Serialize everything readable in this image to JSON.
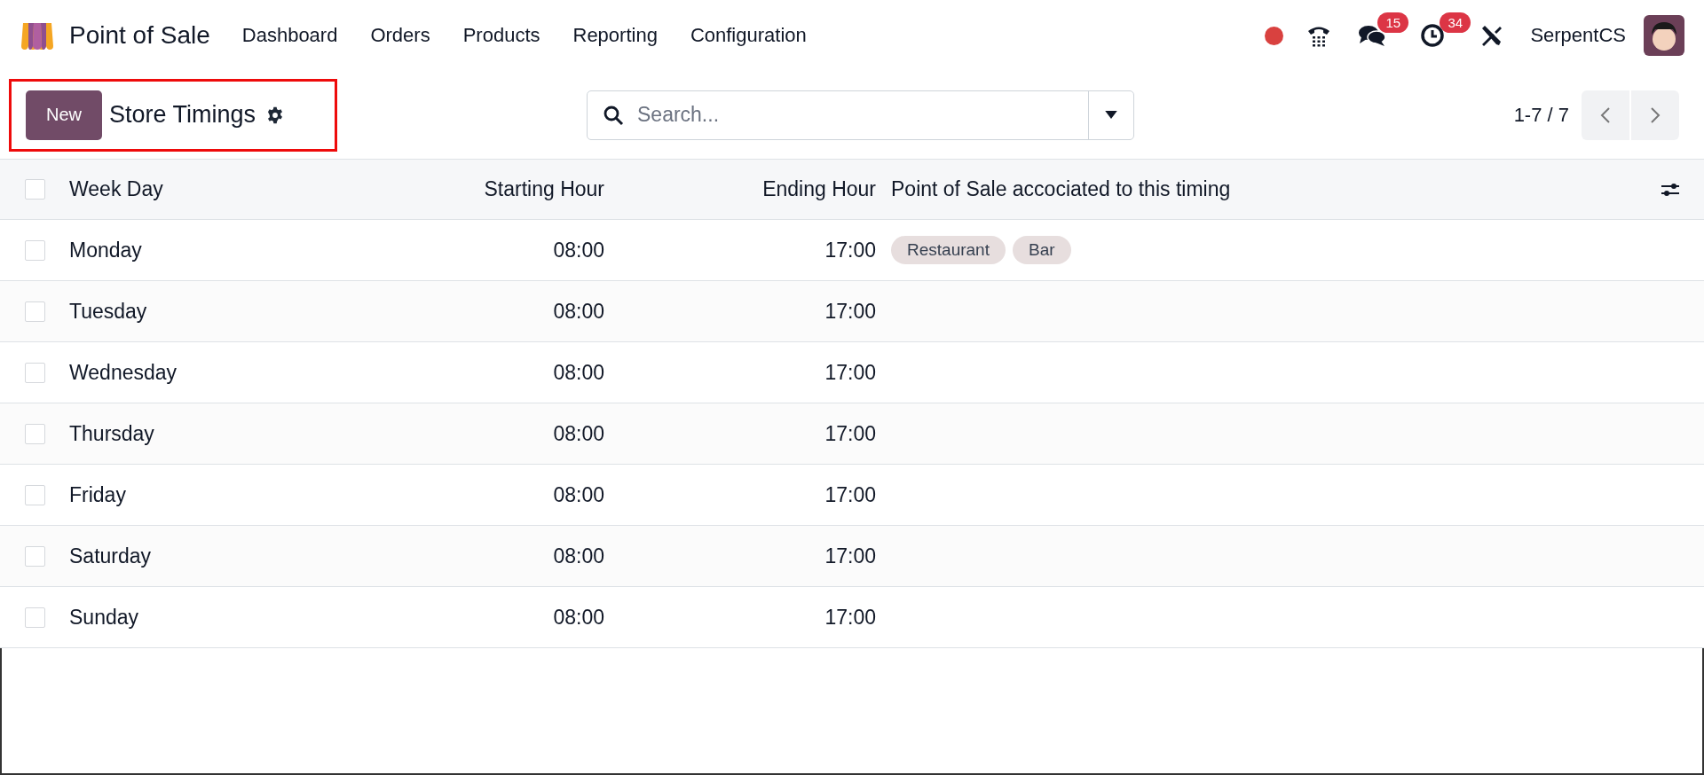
{
  "app": {
    "title": "Point of Sale"
  },
  "menu": [
    {
      "label": "Dashboard"
    },
    {
      "label": "Orders"
    },
    {
      "label": "Products"
    },
    {
      "label": "Reporting"
    },
    {
      "label": "Configuration"
    }
  ],
  "systray": {
    "messages_badge": "15",
    "activities_badge": "34",
    "user": "SerpentCS"
  },
  "control_panel": {
    "new_button": "New",
    "title": "Store Timings",
    "search": {
      "placeholder": "Search..."
    },
    "pager": "1-7 / 7"
  },
  "table": {
    "columns": [
      {
        "label": "Week Day"
      },
      {
        "label": "Starting Hour"
      },
      {
        "label": "Ending Hour"
      },
      {
        "label": "Point of Sale accociated to this timing"
      }
    ],
    "header_checked": false,
    "rows": [
      {
        "week_day": "Monday",
        "starting_hour": "08:00",
        "ending_hour": "17:00",
        "tags": [
          "Restaurant",
          "Bar"
        ],
        "checked": false
      },
      {
        "week_day": "Tuesday",
        "starting_hour": "08:00",
        "ending_hour": "17:00",
        "tags": [],
        "checked": false
      },
      {
        "week_day": "Wednesday",
        "starting_hour": "08:00",
        "ending_hour": "17:00",
        "tags": [],
        "checked": false
      },
      {
        "week_day": "Thursday",
        "starting_hour": "08:00",
        "ending_hour": "17:00",
        "tags": [],
        "checked": false
      },
      {
        "week_day": "Friday",
        "starting_hour": "08:00",
        "ending_hour": "17:00",
        "tags": [],
        "checked": false
      },
      {
        "week_day": "Saturday",
        "starting_hour": "08:00",
        "ending_hour": "17:00",
        "tags": [],
        "checked": false
      },
      {
        "week_day": "Sunday",
        "starting_hour": "08:00",
        "ending_hour": "17:00",
        "tags": [],
        "checked": false
      }
    ]
  }
}
